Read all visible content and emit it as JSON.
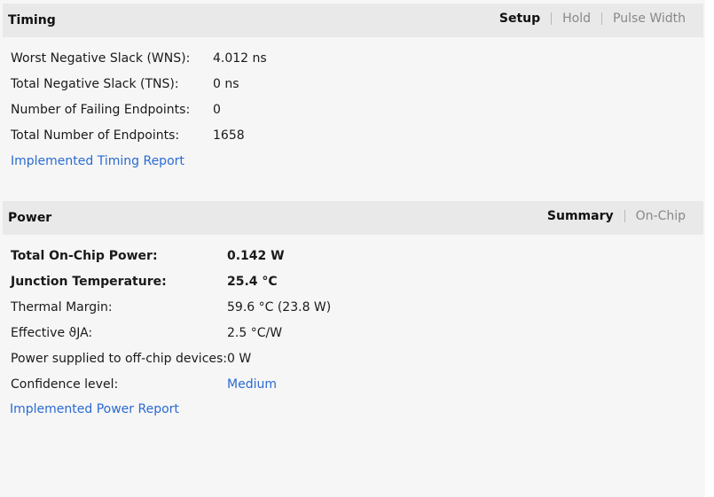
{
  "timing": {
    "title": "Timing",
    "tabs": [
      {
        "label": "Setup",
        "active": true
      },
      {
        "label": "Hold",
        "active": false
      },
      {
        "label": "Pulse Width",
        "active": false
      }
    ],
    "rows": [
      {
        "label": "Worst Negative Slack (WNS):",
        "value": "4.012 ns"
      },
      {
        "label": "Total Negative Slack (TNS):",
        "value": "0 ns"
      },
      {
        "label": "Number of Failing Endpoints:",
        "value": "0"
      },
      {
        "label": "Total Number of Endpoints:",
        "value": "1658"
      }
    ],
    "report_link": "Implemented Timing Report"
  },
  "power": {
    "title": "Power",
    "tabs": [
      {
        "label": "Summary",
        "active": true
      },
      {
        "label": "On-Chip",
        "active": false
      }
    ],
    "rows": [
      {
        "label": "Total On-Chip Power:",
        "value": "0.142 W"
      },
      {
        "label": "Junction Temperature:",
        "value": "25.4 °C"
      },
      {
        "label": "Thermal Margin:",
        "value": "59.6 °C (23.8 W)"
      },
      {
        "label": "Effective ϑJA:",
        "value": "2.5 °C/W"
      },
      {
        "label": "Power supplied to off-chip devices:",
        "value": "0 W"
      },
      {
        "label": "Confidence level:",
        "value": "Medium"
      }
    ],
    "report_link": "Implemented Power Report"
  },
  "colors": {
    "link": "#2a6ad3",
    "header_bg": "#e9e9e9",
    "panel_bg": "#f6f6f6"
  }
}
